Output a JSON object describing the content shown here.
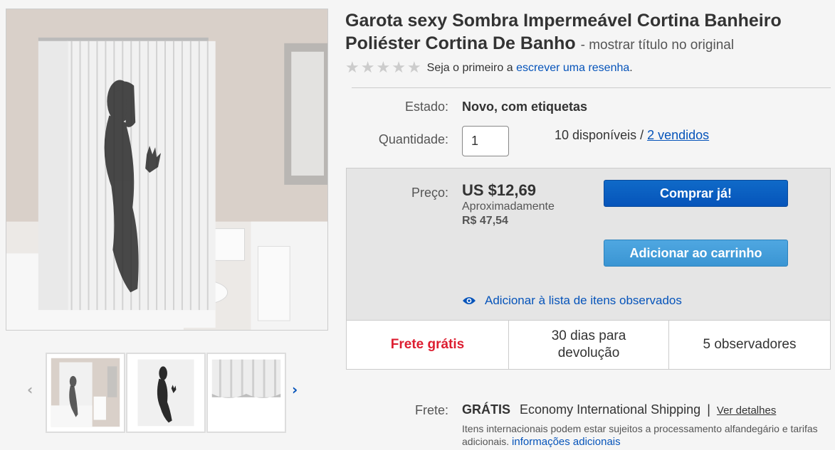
{
  "product": {
    "title": "Garota sexy Sombra Impermeável Cortina Banheiro Poliéster Cortina De Banho",
    "title_suffix": "- mostrar título no original"
  },
  "rating": {
    "stars_filled": 0,
    "stars_total": 5,
    "text_prefix": "Seja o primeiro a",
    "link": "escrever uma resenha",
    "text_suffix": "."
  },
  "details": {
    "estado_label": "Estado:",
    "estado_value": "Novo, com etiquetas",
    "quantity_label": "Quantidade:",
    "quantity_value": "1",
    "available": "10 disponíveis /",
    "sold_link": "2 vendidos"
  },
  "price": {
    "label": "Preço:",
    "value": "US $12,69",
    "approx_label": "Aproximadamente",
    "approx_value": "R$ 47,54",
    "buy_button": "Comprar já!",
    "cart_button": "Adicionar ao carrinho",
    "watch_link": "Adicionar à lista de itens observados"
  },
  "info": {
    "shipping": "Frete grátis",
    "returns": "30 dias para devolução",
    "watchers": "5 observadores"
  },
  "shipping": {
    "label": "Frete:",
    "free": "GRÁTIS",
    "method": "Economy International Shipping",
    "separator": "|",
    "details_link": "Ver detalhes",
    "note": "Itens internacionais podem estar sujeitos a processamento alfandegário e tarifas adicionais.",
    "note_link": "informações adicionais"
  },
  "gallery": {
    "prev_icon": "chevron-left-icon",
    "next_icon": "chevron-right-icon",
    "thumbnail_count": 3
  },
  "colors": {
    "link": "#0654ba",
    "buy_button": "#0654ba",
    "cart_button": "#3a95d3",
    "free_shipping": "#dd1e31"
  }
}
